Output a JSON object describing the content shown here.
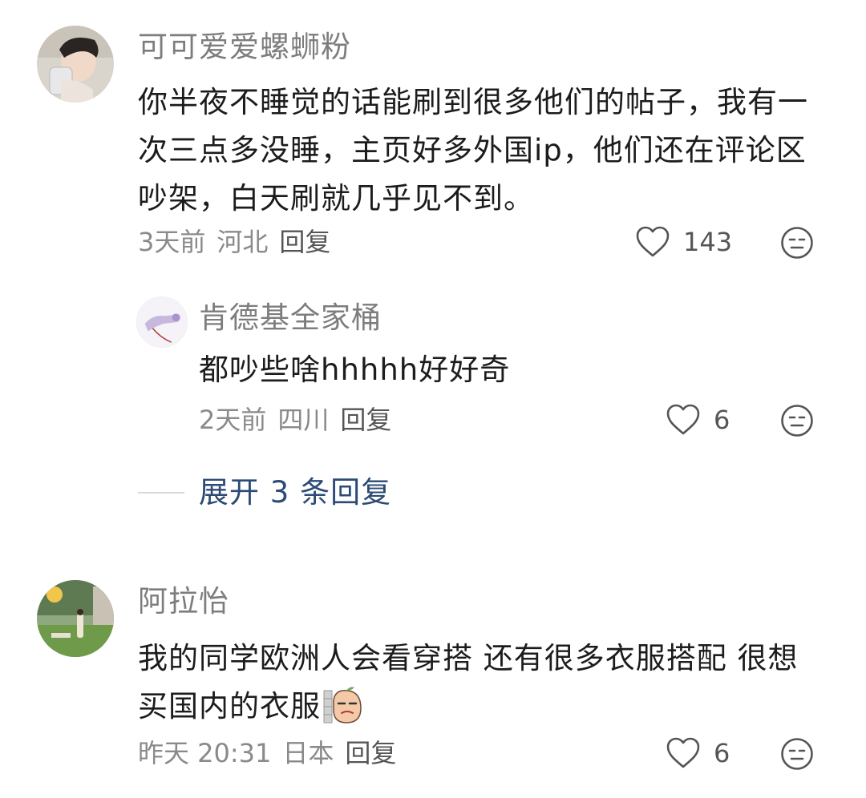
{
  "comments": [
    {
      "username": "可可爱爱螺蛳粉",
      "text": "你半夜不睡觉的话能刷到很多他们的帖子，我有一次三点多没睡，主页好多外国ip，他们还在评论区吵架，白天刷就几乎见不到。",
      "time": "3天前",
      "location": "河北",
      "reply_label": "回复",
      "likes": "143",
      "avatar_icon": "person-drinking-avatar"
    },
    {
      "username": "肯德基全家桶",
      "text": "都吵些啥hhhhh好好奇",
      "time": "2天前",
      "location": "四川",
      "reply_label": "回复",
      "likes": "6",
      "avatar_icon": "purple-sketch-avatar"
    },
    {
      "username": "阿拉怡",
      "text": "我的同学欧洲人会看穿搭 还有很多衣服搭配 很想买国内的衣服",
      "time": "昨天 20:31",
      "location": "日本",
      "reply_label": "回复",
      "likes": "6",
      "avatar_icon": "garden-photo-avatar"
    }
  ],
  "expand_replies": "展开 3 条回复",
  "colors": {
    "username": "#7d7d7d",
    "body": "#1c1c1c",
    "meta": "#8a8a8a",
    "link": "#2c4a75"
  }
}
